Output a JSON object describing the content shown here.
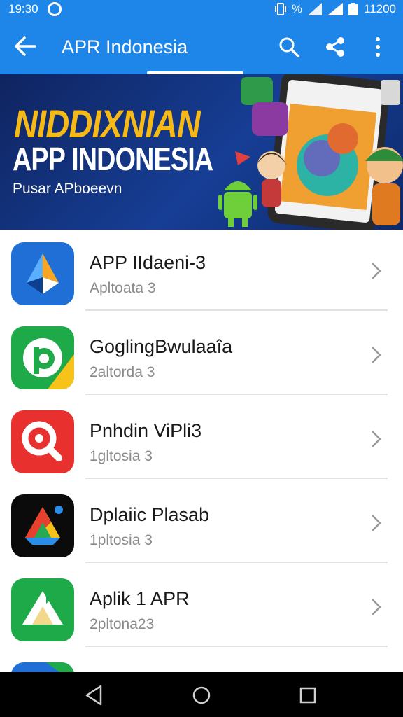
{
  "status_bar": {
    "time": "19:30",
    "percent": "%",
    "battery_text": "11200"
  },
  "app_bar": {
    "title": "APR Indonesia",
    "color": "#1e86e8"
  },
  "banner": {
    "headline": "NIDDIXNIAN",
    "title": "APP INDONESIA",
    "subtitle": "Pusar APboeevn"
  },
  "apps": [
    {
      "name": "APP IIdaeni-3",
      "subtitle": "Apltoata 3",
      "icon": "blue-arrow-icon"
    },
    {
      "name": "GoglingBwulaaîa",
      "subtitle": "2altorda 3",
      "icon": "green-p-icon"
    },
    {
      "name": "Pnhdin ViPli3",
      "subtitle": "1gltosia 3",
      "icon": "red-search-icon"
    },
    {
      "name": "Dplaiic Plasab",
      "subtitle": "1pltosia 3",
      "icon": "drive-triangle-icon"
    },
    {
      "name": "Aplik 1 APR",
      "subtitle": "2pltona23",
      "icon": "green-triangle-icon"
    }
  ]
}
